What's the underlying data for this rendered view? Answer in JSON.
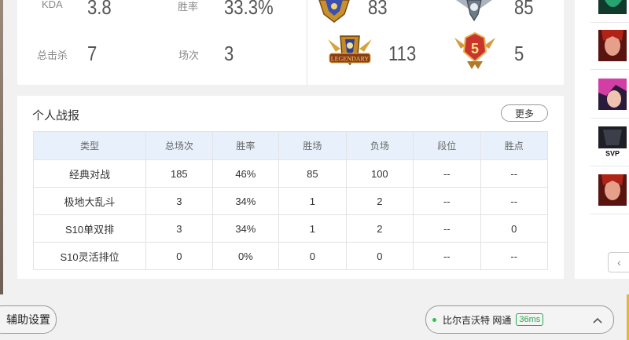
{
  "stats": {
    "kda_label": "KDA",
    "kda_value": "3.8",
    "winrate_label": "胜率",
    "winrate_value": "33.3%",
    "kills_label": "总击杀",
    "kills_value": "7",
    "games_label": "场次",
    "games_value": "3",
    "badges": [
      {
        "name": "gold-rank-icon",
        "count": "83"
      },
      {
        "name": "silver-rank-icon",
        "count": "85"
      },
      {
        "name": "legendary-icon",
        "count": "113",
        "text": "LEGENDARY"
      },
      {
        "name": "level5-medal-icon",
        "count": "5",
        "text": "5"
      }
    ]
  },
  "war_report": {
    "title": "个人战报",
    "more_label": "更多",
    "columns": [
      "类型",
      "总场次",
      "胜率",
      "胜场",
      "负场",
      "段位",
      "胜点"
    ],
    "rows": [
      [
        "经典对战",
        "185",
        "46%",
        "85",
        "100",
        "--",
        "--"
      ],
      [
        "极地大乱斗",
        "3",
        "34%",
        "1",
        "2",
        "--",
        "--"
      ],
      [
        "S10单双排",
        "3",
        "34%",
        "1",
        "2",
        "--",
        "0"
      ],
      [
        "S10灵活排位",
        "0",
        "0%",
        "0",
        "0",
        "--",
        "--"
      ]
    ]
  },
  "colors": {
    "win": "#1a8a3a",
    "lose": "#d6334a",
    "accent": "#2aa84a"
  },
  "right_panel": {
    "champions": [
      "green-champion-icon",
      "red-champion-icon",
      "pink-champion-icon",
      "svp-champion-icon",
      "red-champion-icon"
    ],
    "svp_text": "SVP",
    "nav_arrow": "‹"
  },
  "footer": {
    "assist_label": "辅助设置",
    "server_name": "比尔吉沃特 网通",
    "ping": "36ms",
    "expand_icon": "chevron-up-icon"
  }
}
